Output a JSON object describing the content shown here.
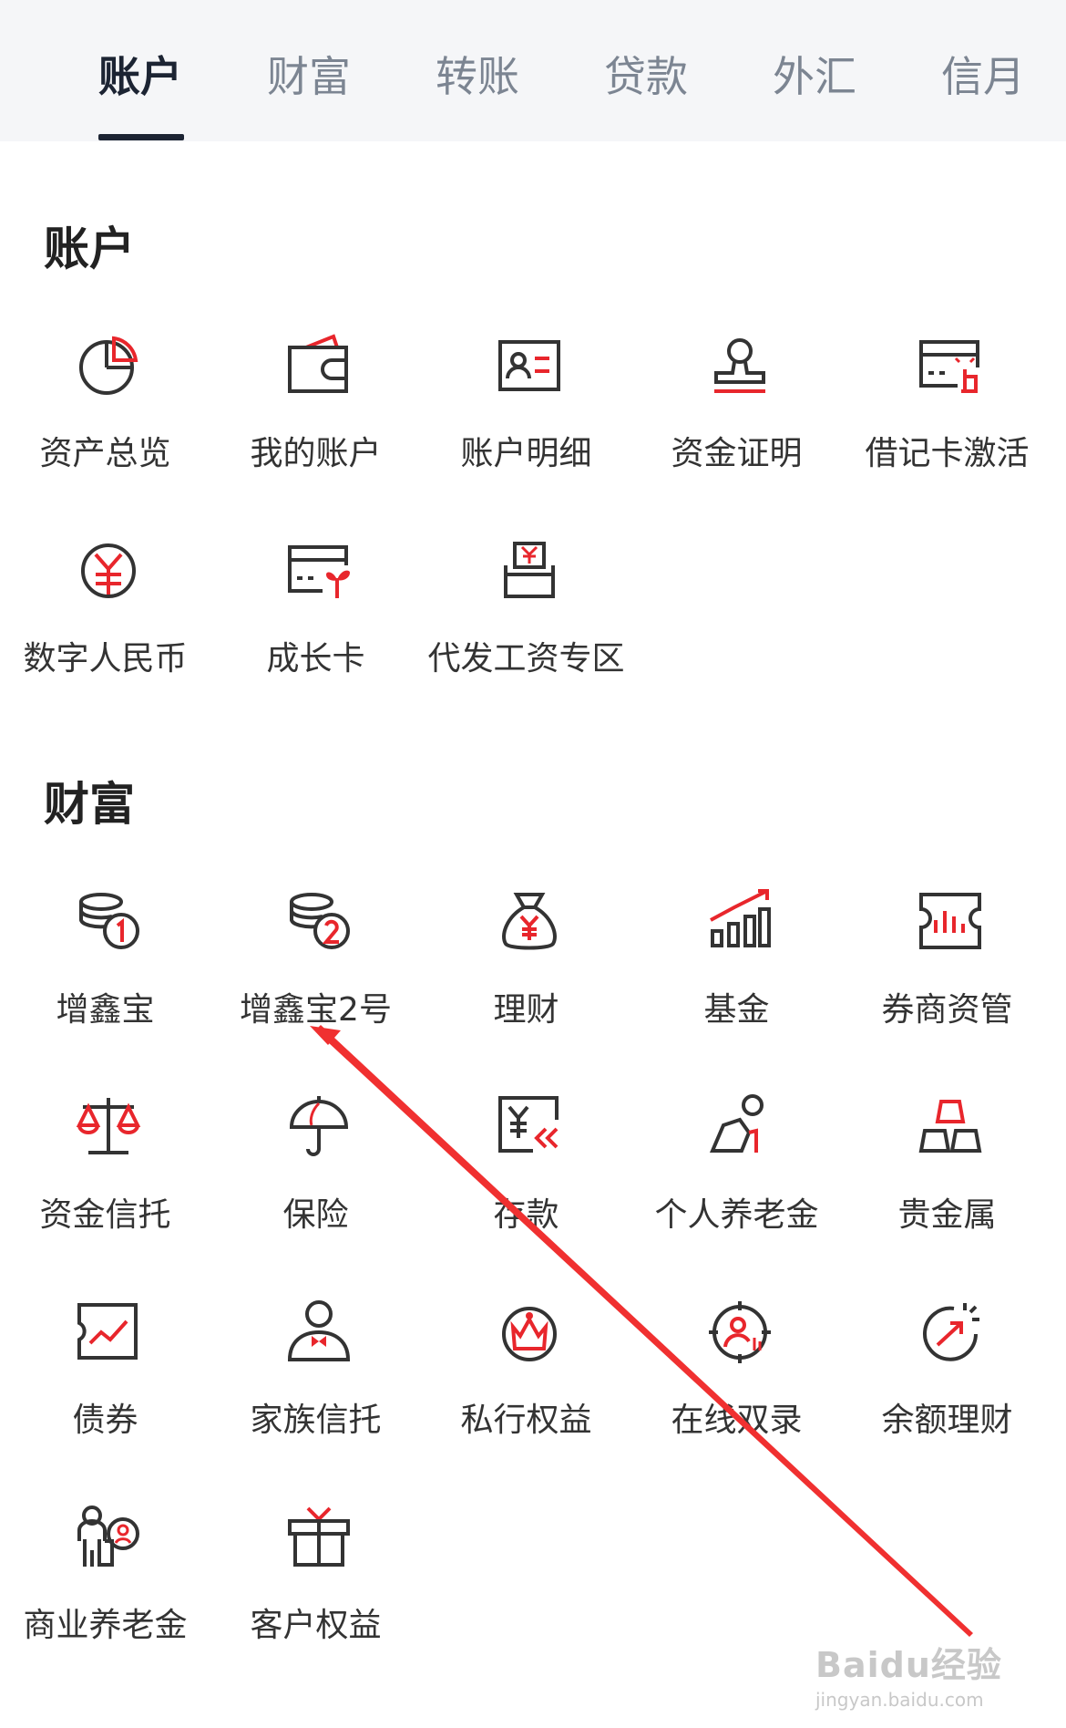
{
  "tabs": [
    {
      "label": "账户",
      "active": true
    },
    {
      "label": "财富",
      "active": false
    },
    {
      "label": "转账",
      "active": false
    },
    {
      "label": "贷款",
      "active": false
    },
    {
      "label": "外汇",
      "active": false
    },
    {
      "label": "信月",
      "active": false
    }
  ],
  "sections": {
    "account": {
      "title": "账户",
      "items": [
        {
          "label": "资产总览",
          "icon": "pie-chart-icon"
        },
        {
          "label": "我的账户",
          "icon": "wallet-icon"
        },
        {
          "label": "账户明细",
          "icon": "id-card-icon"
        },
        {
          "label": "资金证明",
          "icon": "stamp-icon"
        },
        {
          "label": "借记卡激活",
          "icon": "card-tap-icon"
        },
        {
          "label": "数字人民币",
          "icon": "digital-rmb-icon"
        },
        {
          "label": "成长卡",
          "icon": "growth-card-icon"
        },
        {
          "label": "代发工资专区",
          "icon": "salary-envelope-icon"
        }
      ]
    },
    "wealth": {
      "title": "财富",
      "items": [
        {
          "label": "增鑫宝",
          "icon": "coins-1-icon"
        },
        {
          "label": "增鑫宝2号",
          "icon": "coins-2-icon"
        },
        {
          "label": "理财",
          "icon": "money-bag-icon"
        },
        {
          "label": "基金",
          "icon": "bar-trend-icon"
        },
        {
          "label": "券商资管",
          "icon": "ticket-chart-icon"
        },
        {
          "label": "资金信托",
          "icon": "scales-icon"
        },
        {
          "label": "保险",
          "icon": "umbrella-icon"
        },
        {
          "label": "存款",
          "icon": "deposit-icon"
        },
        {
          "label": "个人养老金",
          "icon": "elder-icon"
        },
        {
          "label": "贵金属",
          "icon": "gold-bars-icon"
        },
        {
          "label": "债券",
          "icon": "bond-icon"
        },
        {
          "label": "家族信托",
          "icon": "person-bowtie-icon"
        },
        {
          "label": "私行权益",
          "icon": "crown-icon"
        },
        {
          "label": "在线双录",
          "icon": "target-person-icon"
        },
        {
          "label": "余额理财",
          "icon": "gauge-arrow-icon"
        },
        {
          "label": "商业养老金",
          "icon": "family-icon"
        },
        {
          "label": "客户权益",
          "icon": "gift-icon"
        }
      ]
    }
  },
  "colors": {
    "accent": "#e8262c",
    "icon_stroke": "#333333",
    "tab_bg": "#f5f6f8"
  },
  "watermark": {
    "brand": "Baidu经验",
    "url": "jingyan.baidu.com"
  }
}
